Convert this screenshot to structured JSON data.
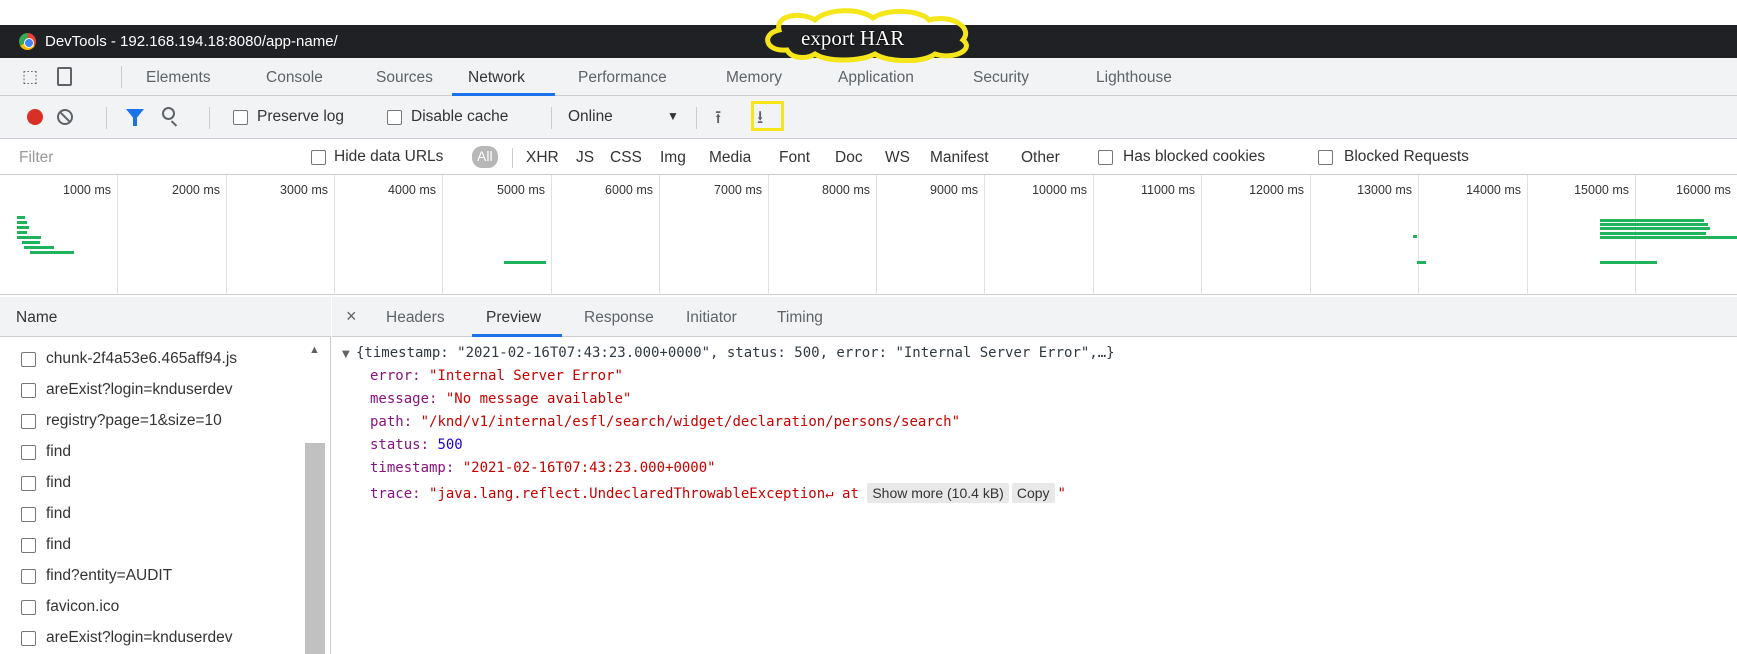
{
  "window": {
    "title": "DevTools - 192.168.194.18:8080/app-name/"
  },
  "annotation": {
    "text": "export HAR",
    "color": "#f5e61a"
  },
  "tabs": {
    "items": [
      "Elements",
      "Console",
      "Sources",
      "Network",
      "Performance",
      "Memory",
      "Application",
      "Security",
      "Lighthouse"
    ],
    "active": "Network"
  },
  "toolbar": {
    "preserve_log": "Preserve log",
    "disable_cache": "Disable cache",
    "throttling": "Online"
  },
  "filter": {
    "placeholder": "Filter",
    "hide_data_urls": "Hide data URLs",
    "types": [
      "All",
      "XHR",
      "JS",
      "CSS",
      "Img",
      "Media",
      "Font",
      "Doc",
      "WS",
      "Manifest",
      "Other"
    ],
    "has_blocked_cookies": "Has blocked cookies",
    "blocked_requests": "Blocked Requests"
  },
  "timeline": {
    "ticks": [
      "1000 ms",
      "2000 ms",
      "3000 ms",
      "4000 ms",
      "5000 ms",
      "6000 ms",
      "7000 ms",
      "8000 ms",
      "9000 ms",
      "10000 ms",
      "11000 ms",
      "12000 ms",
      "13000 ms",
      "14000 ms",
      "15000 ms",
      "16000 ms"
    ],
    "bar_color": "#1fb45b"
  },
  "requests": {
    "header": "Name",
    "rows": [
      "chunk-2f4a53e6.465aff94.js",
      "areExist?login=knduserdev",
      "registry?page=1&size=10",
      "find",
      "find",
      "find",
      "find",
      "find?entity=AUDIT",
      "favicon.ico",
      "areExist?login=knduserdev"
    ]
  },
  "detail": {
    "tabs": [
      "Headers",
      "Preview",
      "Response",
      "Initiator",
      "Timing"
    ],
    "active": "Preview"
  },
  "preview": {
    "summary": "{timestamp: \"2021-02-16T07:43:23.000+0000\", status: 500, error: \"Internal Server Error\",…}",
    "error_key": "error:",
    "error_val": "\"Internal Server Error\"",
    "message_key": "message:",
    "message_val": "\"No message available\"",
    "path_key": "path:",
    "path_val": "\"/knd/v1/internal/esfl/search/widget/declaration/persons/search\"",
    "status_key": "status:",
    "status_val": "500",
    "timestamp_key": "timestamp:",
    "timestamp_val": "\"2021-02-16T07:43:23.000+0000\"",
    "trace_key": "trace:",
    "trace_val": "\"java.lang.reflect.UndeclaredThrowableException↵ at",
    "show_more": "Show more (10.4 kB)",
    "copy": "Copy",
    "trace_end": "\""
  }
}
